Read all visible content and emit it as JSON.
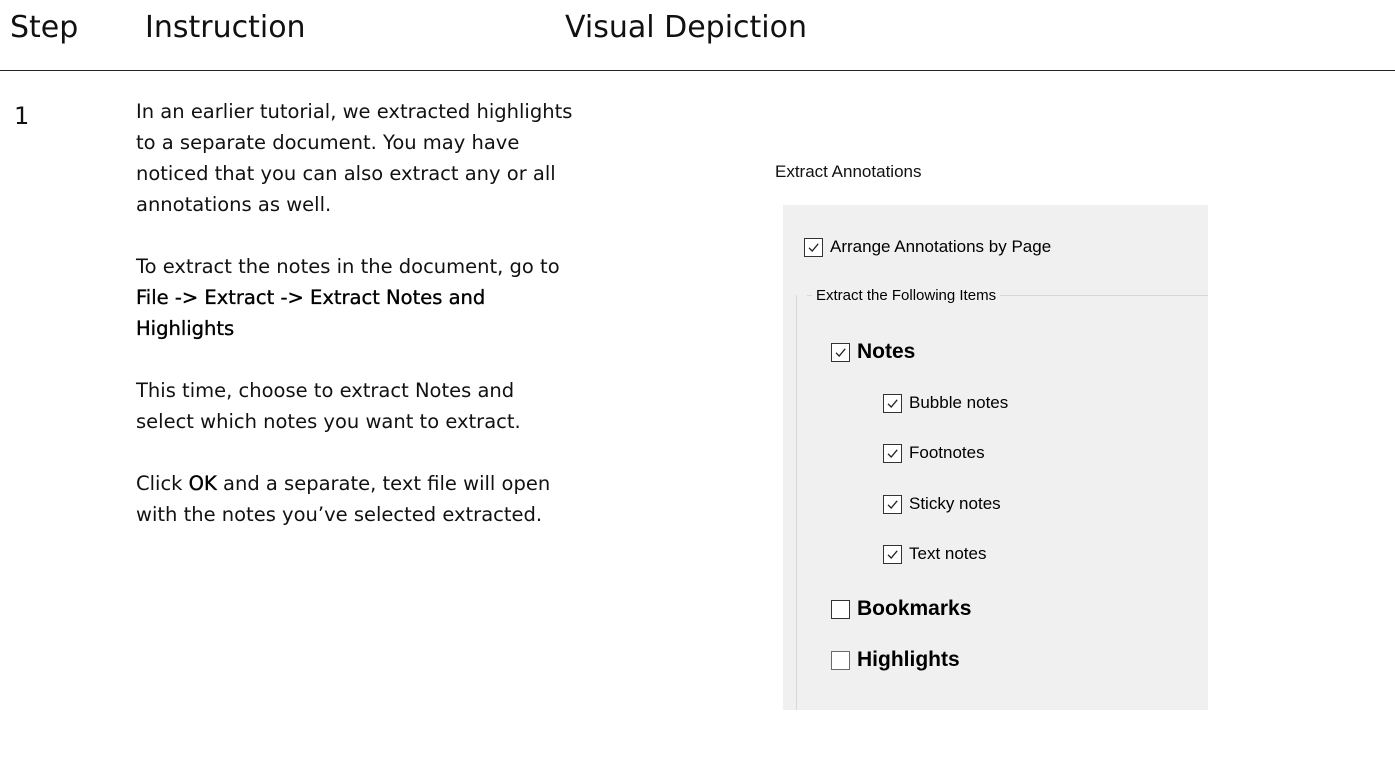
{
  "header": {
    "step": "Step",
    "instruction": "Instruction",
    "visual": "Visual Depiction"
  },
  "step_number": "1",
  "instructions": {
    "p1": "In an earlier tutorial, we extracted highlights to a separate document.  You may have noticed that you can also extract any or all annotations as well.",
    "p2_prefix": "To extract the notes in the document, go to ",
    "p2_path": "File -> Extract -> Extract Notes and Highlights",
    "p3": "This time, choose to extract Notes and select which notes you want to extract.",
    "p4_prefix": "Click ",
    "p4_ok": "OK",
    "p4_suffix": " and a separate, text file will open with the notes you’ve selected extracted."
  },
  "dialog": {
    "title": "Extract Annotations",
    "arrange_by_page": {
      "label": "Arrange Annotations by Page",
      "checked": true
    },
    "group_label": "Extract the Following Items",
    "notes": {
      "label": "Notes",
      "checked": true
    },
    "note_types": [
      {
        "label": "Bubble notes",
        "checked": true
      },
      {
        "label": "Footnotes",
        "checked": true
      },
      {
        "label": "Sticky notes",
        "checked": true
      },
      {
        "label": "Text notes",
        "checked": true
      }
    ],
    "bookmarks": {
      "label": "Bookmarks",
      "checked": false
    },
    "highlights": {
      "label": "Highlights",
      "checked": false
    }
  },
  "colors": {
    "panel_bg": "#f0f0f0",
    "checkbox_border": "#333333",
    "checkbox_hover_border": "#1e7bd6"
  }
}
